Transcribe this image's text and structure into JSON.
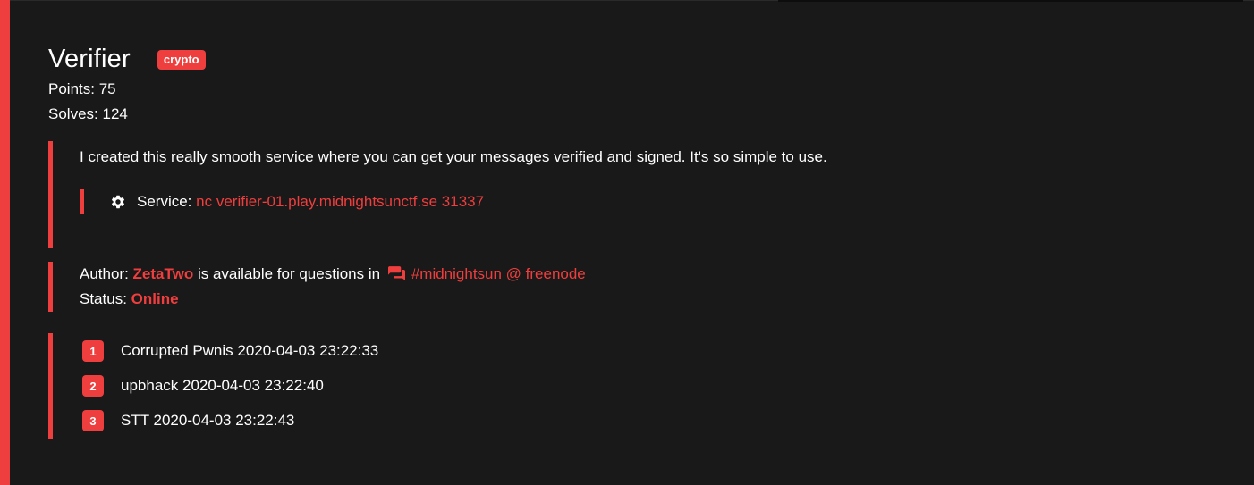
{
  "challenge": {
    "title": "Verifier",
    "category": "crypto",
    "points_label": "Points:",
    "points": "75",
    "solves_label": "Solves:",
    "solves": "124",
    "description": "I created this really smooth service where you can get your messages verified and signed. It's so simple to use.",
    "service_label": "Service:",
    "service_value": "nc verifier-01.play.midnightsunctf.se 31337",
    "author_label": "Author:",
    "author": "ZetaTwo",
    "availability_text": "is available for questions in",
    "channel": "#midnightsun @ freenode",
    "status_label": "Status:",
    "status": "Online"
  },
  "solves_list": [
    {
      "rank": "1",
      "text": "Corrupted Pwnis 2020-04-03 23:22:33"
    },
    {
      "rank": "2",
      "text": "upbhack 2020-04-03 23:22:40"
    },
    {
      "rank": "3",
      "text": "STT 2020-04-03 23:22:43"
    }
  ],
  "colors": {
    "accent": "#ef3e3e",
    "background": "#191919",
    "text": "#ffffff"
  },
  "icons": {
    "service": "gear-icon",
    "channel": "chat-icon"
  }
}
